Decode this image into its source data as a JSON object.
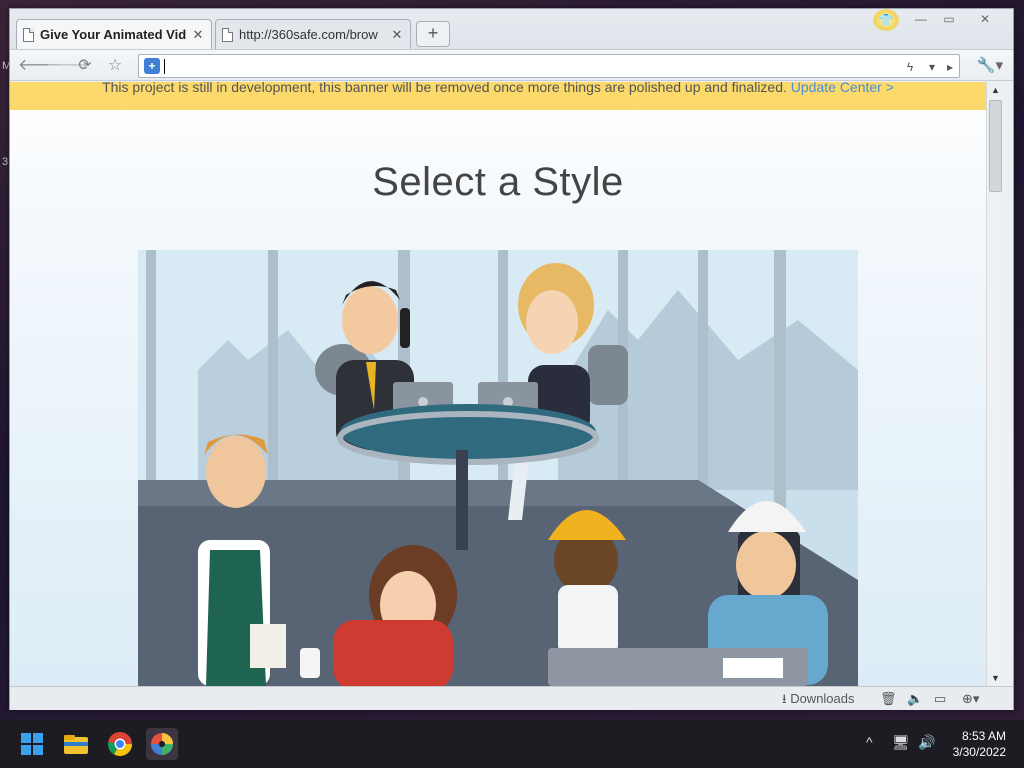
{
  "desktop": {
    "left_glyphs": [
      "M",
      "3"
    ]
  },
  "browser": {
    "tabs": [
      {
        "title": "Give Your Animated Vid",
        "active": true
      },
      {
        "title": "http://360safe.com/brow",
        "active": false
      }
    ],
    "new_tab_label": "+",
    "window_controls": {
      "minimize": "—",
      "maximize": "▭",
      "close": "✕"
    },
    "address": {
      "value": "",
      "placeholder": ""
    },
    "status": {
      "downloads_label": "Downloads"
    }
  },
  "page": {
    "banner_text": "This project is still in development, this banner will be removed once more things are polished up and finalized.",
    "banner_link": "Update Center >",
    "heading": "Select a Style"
  },
  "taskbar": {
    "time": "8:53 AM",
    "date": "3/30/2022"
  },
  "colors": {
    "banner": "#fbd96a",
    "link": "#4a8fd6",
    "heading": "#444444"
  }
}
